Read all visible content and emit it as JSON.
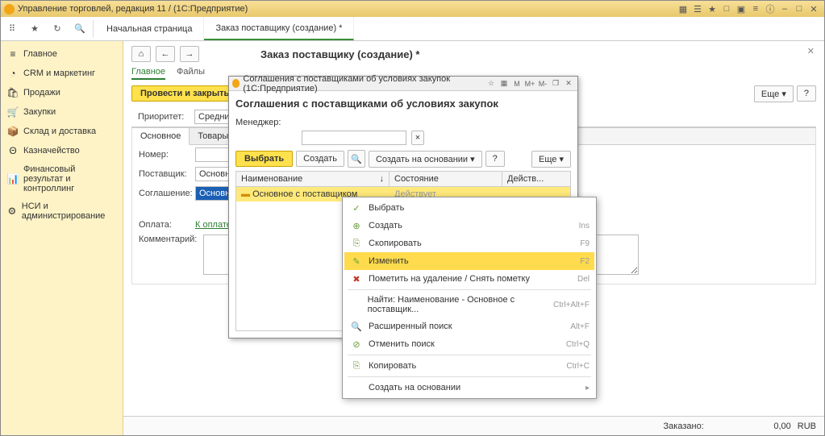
{
  "titlebar": {
    "text": "Управление торговлей, редакция 11 / (1С:Предприятие)"
  },
  "tabs": {
    "home": "Начальная страница",
    "order": "Заказ поставщику (создание) *"
  },
  "sidebar": [
    {
      "icon": "≡",
      "label": "Главное"
    },
    {
      "icon": "◔",
      "label": "CRM и маркетинг"
    },
    {
      "icon": "🛍",
      "label": "Продажи"
    },
    {
      "icon": "🛒",
      "label": "Закупки"
    },
    {
      "icon": "📦",
      "label": "Склад и доставка"
    },
    {
      "icon": "Θ",
      "label": "Казначейство"
    },
    {
      "icon": "📊",
      "label": "Финансовый результат и контроллинг"
    },
    {
      "icon": "⚙",
      "label": "НСИ и администрирование"
    }
  ],
  "page": {
    "title": "Заказ поставщику (создание) *",
    "tab_main": "Главное",
    "tab_files": "Файлы"
  },
  "toolbar": {
    "submit": "Провести и закрыть",
    "more": "Еще",
    "help": "?"
  },
  "priority": {
    "label": "Приоритет:",
    "value": "Средний"
  },
  "formtabs": {
    "main": "Основное",
    "goods": "Товары"
  },
  "form": {
    "number_label": "Номер:",
    "supplier_label": "Поставщик:",
    "supplier_value": "Основной",
    "agreement_label": "Соглашение:",
    "agreement_value": "Основное",
    "payment_label": "Оплата:",
    "payment_value": "К оплате,",
    "comment_label": "Комментарий:"
  },
  "footer": {
    "ordered": "Заказано:",
    "amount": "0,00",
    "currency": "RUB"
  },
  "modal": {
    "title": "Соглашения с поставщиками об условиях закупок  (1С:Предприятие)",
    "header": "Соглашения с поставщиками об условиях закупок",
    "manager_label": "Менеджер:",
    "btn_select": "Выбрать",
    "btn_create": "Создать",
    "btn_basedon": "Создать на основании",
    "btn_more": "Еще",
    "btn_help": "?",
    "col_name": "Наименование",
    "col_state": "Состояние",
    "col_act": "Действ...",
    "row_name": "Основное с поставщиком",
    "row_state": "Действует",
    "mt": {
      "m": "M",
      "mp": "M+",
      "mm": "M-"
    }
  },
  "ctx": [
    {
      "icon": "✓",
      "label": "Выбрать",
      "sc": ""
    },
    {
      "icon": "⊕",
      "label": "Создать",
      "sc": "Ins"
    },
    {
      "icon": "⎘",
      "label": "Скопировать",
      "sc": "F9"
    },
    {
      "icon": "✎",
      "label": "Изменить",
      "sc": "F2",
      "hi": true
    },
    {
      "icon": "✖",
      "label": "Пометить на удаление / Снять пометку",
      "sc": "Del"
    },
    {
      "icon": "",
      "label": "Найти: Наименование - Основное с поставщик...",
      "sc": "Ctrl+Alt+F"
    },
    {
      "icon": "🔍",
      "label": "Расширенный поиск",
      "sc": "Alt+F"
    },
    {
      "icon": "⊘",
      "label": "Отменить поиск",
      "sc": "Ctrl+Q"
    },
    {
      "icon": "⎘",
      "label": "Копировать",
      "sc": "Ctrl+C"
    },
    {
      "icon": "",
      "label": "Создать на основании",
      "sc": "▸"
    }
  ]
}
